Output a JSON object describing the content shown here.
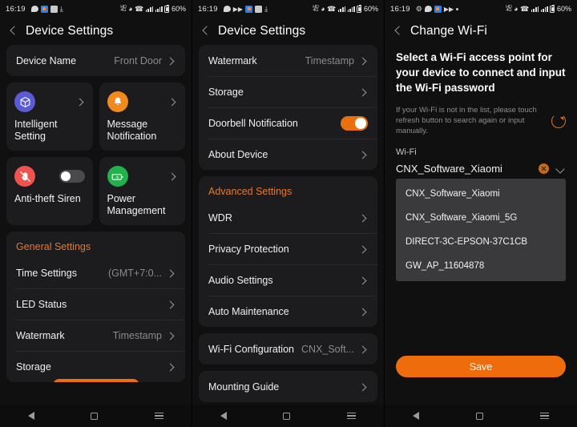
{
  "statusbar": {
    "time": "16:19",
    "battery_pct": "60%",
    "network_label": "HD",
    "left_icons": [
      "chat-icon",
      "camera-icon",
      "screenshot-icon",
      "download-icon"
    ],
    "left_icons_2": [
      "chat-icon",
      "skip-icon",
      "camera-icon",
      "screenshot-icon",
      "download-icon"
    ],
    "left_icons_3": [
      "bluetooth-icon",
      "chat-icon",
      "camera-icon",
      "skip-icon",
      "dot-icon"
    ],
    "right_icons": [
      "hd-icon",
      "wifi-icon",
      "call-icon",
      "signal-icon",
      "signal-icon",
      "battery-icon"
    ]
  },
  "panel1": {
    "title": "Device Settings",
    "device_name_row": {
      "label": "Device Name",
      "value": "Front Door"
    },
    "tiles": [
      {
        "label": "Intelligent Setting",
        "icon": "cube-icon",
        "icon_color": "#5b5bd6",
        "control": "chevron"
      },
      {
        "label": "Message Notification",
        "icon": "bell-icon",
        "icon_color": "#f08a1d",
        "control": "chevron"
      },
      {
        "label": "Anti-theft Siren",
        "icon": "hand-stop-icon",
        "icon_color": "#ef5350",
        "control": "toggle",
        "toggle_on": false
      },
      {
        "label": "Power Management",
        "icon": "battery-charging-icon",
        "icon_color": "#21b24b",
        "control": "chevron"
      }
    ],
    "section_title": "General Settings",
    "rows": [
      {
        "label": "Time Settings",
        "value": "(GMT+7:0..."
      },
      {
        "label": "LED Status",
        "value": ""
      },
      {
        "label": "Watermark",
        "value": "Timestamp"
      },
      {
        "label": "Storage",
        "value": ""
      }
    ]
  },
  "panel2": {
    "title": "Device Settings",
    "group1": [
      {
        "label": "Watermark",
        "value": "Timestamp",
        "control": "chevron"
      },
      {
        "label": "Storage",
        "value": "",
        "control": "chevron"
      },
      {
        "label": "Doorbell Notification",
        "value": "",
        "control": "toggle",
        "toggle_on": true
      },
      {
        "label": "About Device",
        "value": "",
        "control": "chevron"
      }
    ],
    "section_title": "Advanced Settings",
    "group2": [
      {
        "label": "WDR",
        "value": "",
        "control": "chevron"
      },
      {
        "label": "Privacy Protection",
        "value": "",
        "control": "chevron"
      },
      {
        "label": "Audio Settings",
        "value": "",
        "control": "chevron"
      },
      {
        "label": "Auto Maintenance",
        "value": "",
        "control": "chevron"
      }
    ],
    "group3": [
      {
        "label": "Wi-Fi Configuration",
        "value": "CNX_Soft...",
        "control": "chevron"
      }
    ],
    "group4": [
      {
        "label": "Mounting Guide",
        "value": "",
        "control": "chevron"
      }
    ]
  },
  "panel3": {
    "title": "Change Wi-Fi",
    "heading": "Select a Wi-Fi access point for your device to connect and input the Wi-Fi password",
    "note": "If your Wi-Fi is not in the list, please touch refresh button to search again or input manually.",
    "refresh_icon": "refresh-icon",
    "wifi_label": "Wi-Fi",
    "wifi_selected": "CNX_Software_Xiaomi",
    "wifi_options": [
      "CNX_Software_Xiaomi",
      "CNX_Software_Xiaomi_5G",
      "DIRECT-3C-EPSON-37C1CB",
      "GW_AP_11604878"
    ],
    "save_label": "Save"
  },
  "navbar": {
    "back": "nav-back-icon",
    "home": "nav-home-icon",
    "recents": "nav-recents-icon"
  },
  "colors": {
    "accent": "#e8700f",
    "card": "#1c1c1e",
    "background": "#101010",
    "dropdown": "#3a3a3c",
    "muted": "#8a8a8e"
  }
}
